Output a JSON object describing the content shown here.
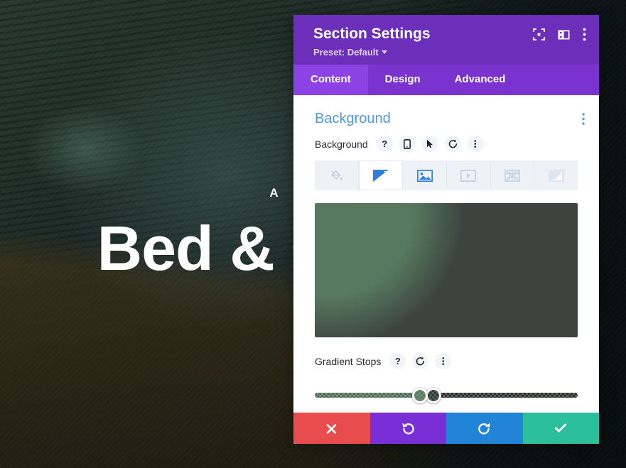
{
  "page": {
    "hero_eyebrow": "A HOME",
    "hero_title": "Bed & Comfort",
    "overlay_tint": "#2e6042"
  },
  "modal": {
    "title": "Section Settings",
    "preset_label": "Preset: Default",
    "header_icons": [
      {
        "name": "focus-icon",
        "label": "Focus"
      },
      {
        "name": "layout-panel-icon",
        "label": "Layout"
      },
      {
        "name": "kebab-menu-icon",
        "label": "More options"
      }
    ],
    "tabs": [
      {
        "label": "Content",
        "active": true
      },
      {
        "label": "Design",
        "active": false
      },
      {
        "label": "Advanced",
        "active": false
      }
    ],
    "accent_purple": "#6c2fba",
    "tab_active_purple": "#8d42e6",
    "tab_bar_purple": "#7a33cf"
  },
  "background_section": {
    "title": "Background",
    "title_color": "#4c9ae8",
    "kebab": "section-kebab-icon",
    "field_label": "Background",
    "field_icons": [
      {
        "name": "help-icon",
        "glyph": "?"
      },
      {
        "name": "responsive-mobile-icon",
        "glyph": "mobile"
      },
      {
        "name": "hover-cursor-icon",
        "glyph": "cursor"
      },
      {
        "name": "reset-icon",
        "glyph": "undo"
      },
      {
        "name": "options-kebab-icon",
        "glyph": "kebab"
      }
    ],
    "types": [
      {
        "name": "background-color",
        "label": "Color",
        "active": false
      },
      {
        "name": "background-gradient",
        "label": "Gradient",
        "active": true
      },
      {
        "name": "background-image",
        "label": "Image",
        "active": false
      },
      {
        "name": "background-video",
        "label": "Video",
        "active": false
      },
      {
        "name": "background-pattern",
        "label": "Pattern",
        "active": false
      },
      {
        "name": "background-mask",
        "label": "Mask",
        "active": false
      }
    ]
  },
  "gradient": {
    "preview_css": "radial-gradient(circle 300px at 6% 8%, #577a5f 0%, #577a5f 38%, #3d4440 62%, #3d4440 100%)",
    "start_color": "#577a5f",
    "end_color": "#333d39",
    "stops_label": "Gradient Stops",
    "stops_icons": [
      {
        "name": "help-icon",
        "glyph": "?"
      },
      {
        "name": "reset-icon",
        "glyph": "undo"
      },
      {
        "name": "options-kebab-icon",
        "glyph": "kebab"
      }
    ],
    "stops": [
      {
        "name": "gradient-stop-start",
        "position": 40,
        "color": "#577a5f"
      },
      {
        "name": "gradient-stop-end",
        "position": 45,
        "color": "#333d39"
      }
    ],
    "track_css": "linear-gradient(to right, #4f6e56 0%, #4f6e56 40%, #2b322e 45%, #2b322e 100%)"
  },
  "actions": [
    {
      "name": "cancel-button",
      "label": "Cancel",
      "color": "#e84c4c",
      "icon": "close-icon"
    },
    {
      "name": "undo-button",
      "label": "Undo",
      "color": "#7a2fd6",
      "icon": "undo-icon"
    },
    {
      "name": "redo-button",
      "label": "Redo",
      "color": "#2284d6",
      "icon": "redo-icon"
    },
    {
      "name": "save-button",
      "label": "Save",
      "color": "#2bbf9b",
      "icon": "check-icon"
    }
  ]
}
